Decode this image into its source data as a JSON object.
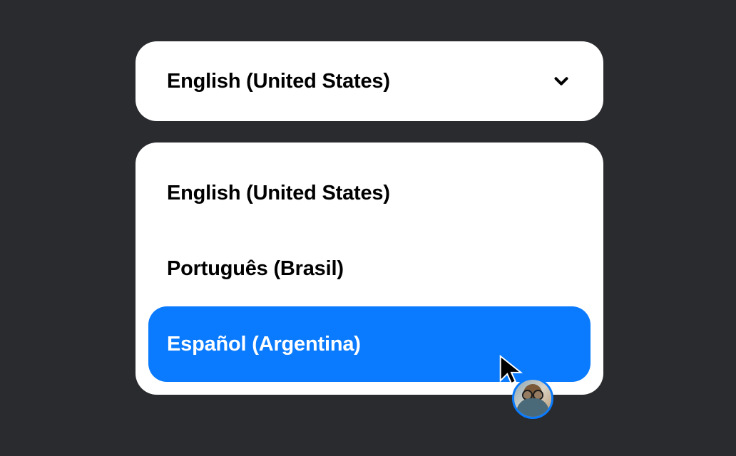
{
  "selector": {
    "selected_label": "English (United States)",
    "options": [
      {
        "label": "English (United States)",
        "highlighted": false
      },
      {
        "label": "Português (Brasil)",
        "highlighted": false
      },
      {
        "label": "Español (Argentina)",
        "highlighted": true
      }
    ]
  },
  "colors": {
    "background": "#2a2b2e",
    "panel": "#ffffff",
    "highlight": "#0a7bff",
    "text": "#000000",
    "text_highlight": "#ffffff"
  }
}
